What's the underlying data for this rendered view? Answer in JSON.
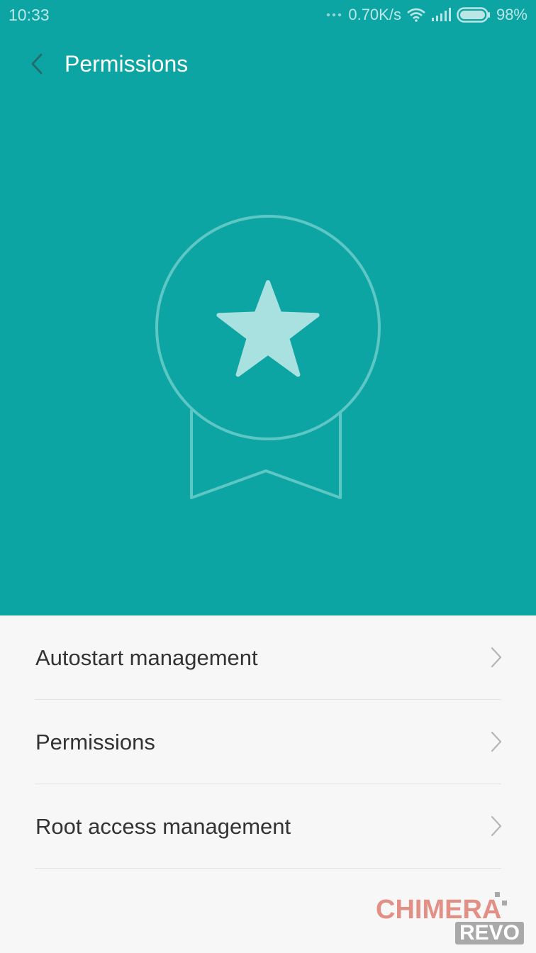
{
  "status_bar": {
    "time": "10:33",
    "network_speed": "0.70K/s",
    "battery": "98%",
    "icons": [
      "dots-icon",
      "wifi-icon",
      "signal-icon",
      "battery-icon"
    ],
    "battery_level": 0.98
  },
  "header": {
    "back_icon": "chevron-left-icon",
    "title": "Permissions"
  },
  "hero": {
    "background_color": "#0da5a3",
    "illustration": "medal-star-icon"
  },
  "menu": {
    "items": [
      {
        "label": "Autostart management",
        "icon": "chevron-right-icon"
      },
      {
        "label": "Permissions",
        "icon": "chevron-right-icon"
      },
      {
        "label": "Root access management",
        "icon": "chevron-right-icon"
      }
    ]
  },
  "watermark": {
    "top": "CHIMERA",
    "bottom": "REVO"
  }
}
